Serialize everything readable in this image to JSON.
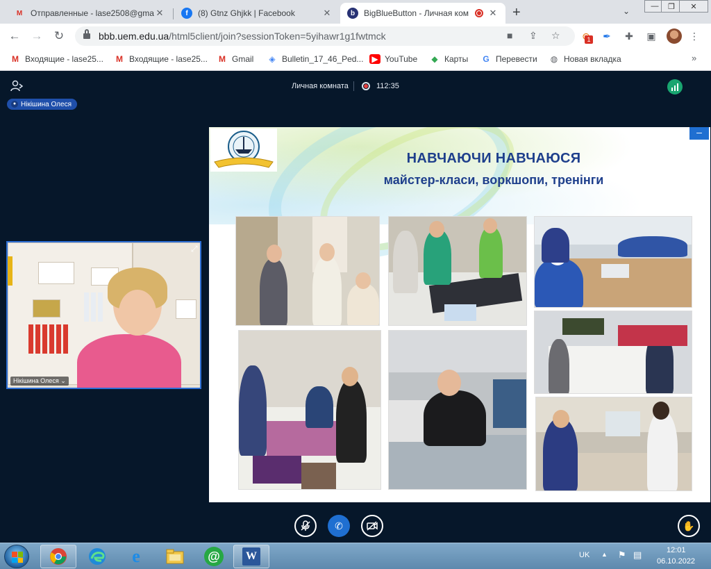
{
  "browser": {
    "tabs": [
      {
        "title": "Отправленные - lase2508@gma",
        "icon": "gmail-icon",
        "active": false
      },
      {
        "title": "(8) Gtnz Ghjkk | Facebook",
        "icon": "facebook-icon",
        "active": false
      },
      {
        "title": "BigBlueButton - Личная ком",
        "icon": "bigbluebutton-icon",
        "active": true,
        "recording": true
      }
    ],
    "url_host": "bbb.uem.edu.ua",
    "url_path": "/html5client/join?sessionToken=5yihawr1g1fwtmck",
    "extension_badge": "1",
    "bookmarks": [
      {
        "label": "Входящие - lase25...",
        "icon": "gmail-icon"
      },
      {
        "label": "Входящие - lase25...",
        "icon": "gmail-icon"
      },
      {
        "label": "Gmail",
        "icon": "gmail-icon"
      },
      {
        "label": "Bulletin_17_46_Ped...",
        "icon": "link-icon"
      },
      {
        "label": "YouTube",
        "icon": "youtube-icon"
      },
      {
        "label": "Карты",
        "icon": "maps-icon"
      },
      {
        "label": "Перевести",
        "icon": "translate-icon"
      },
      {
        "label": "Новая вкладка",
        "icon": "globe-icon"
      }
    ],
    "bookmarks_more": "»"
  },
  "meeting": {
    "user_name": "Нікішина Олеся",
    "room_title": "Личная комната",
    "timer": "112:35",
    "webcam_label": "Нікішина Олеся",
    "slide": {
      "heading": "НАВЧАЮЧИ НАВЧАЮСЯ",
      "subheading": "майстер-класи, воркшопи, тренінги"
    }
  },
  "taskbar": {
    "language": "UK",
    "time": "12:01",
    "date": "06.10.2022"
  },
  "colors": {
    "app_bg": "#06172a",
    "accent_blue": "#1f6fd1",
    "slide_title": "#1e3f8c",
    "connection_green": "#19a570"
  }
}
